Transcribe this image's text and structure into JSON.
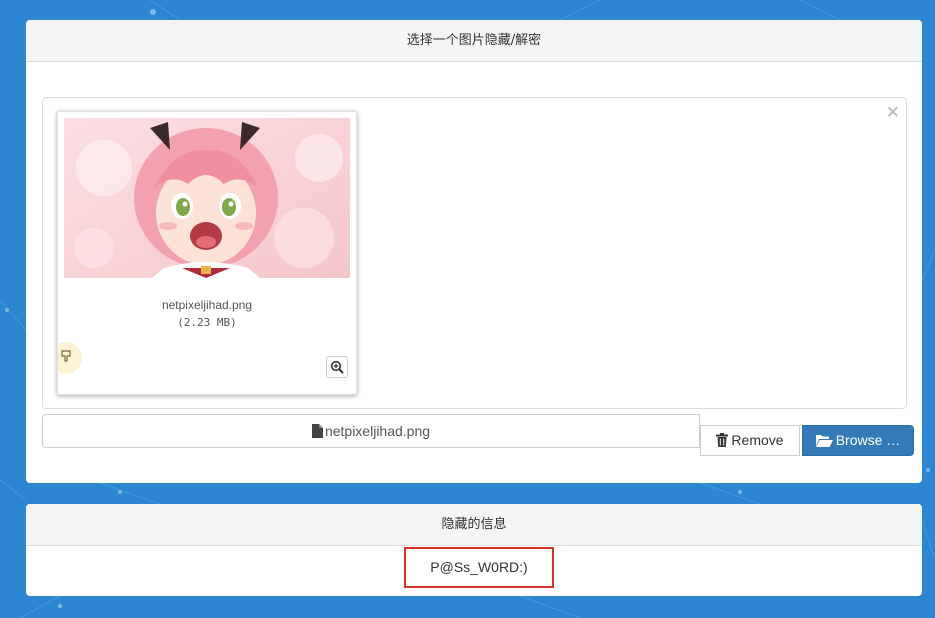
{
  "panel_select": {
    "title": "选择一个图片隐藏/解密"
  },
  "preview": {
    "file_name": "netpixeljihad.png",
    "file_size": "(2.23 MB)",
    "close_symbol": "×"
  },
  "file_input": {
    "caption_name": "netpixeljihad.png",
    "remove_label": "Remove",
    "browse_label": "Browse …"
  },
  "panel_message": {
    "title": "隐藏的信息",
    "message": "P@Ss_W0RD:)"
  },
  "colors": {
    "background": "#2c86d2",
    "primary_button": "#337ab7",
    "highlight_border": "#d9312b"
  },
  "icons": {
    "close": "close-icon",
    "drag": "drag-handle-icon",
    "zoom": "zoom-in-icon",
    "file": "file-icon",
    "trash": "trash-icon",
    "folder": "folder-open-icon"
  }
}
